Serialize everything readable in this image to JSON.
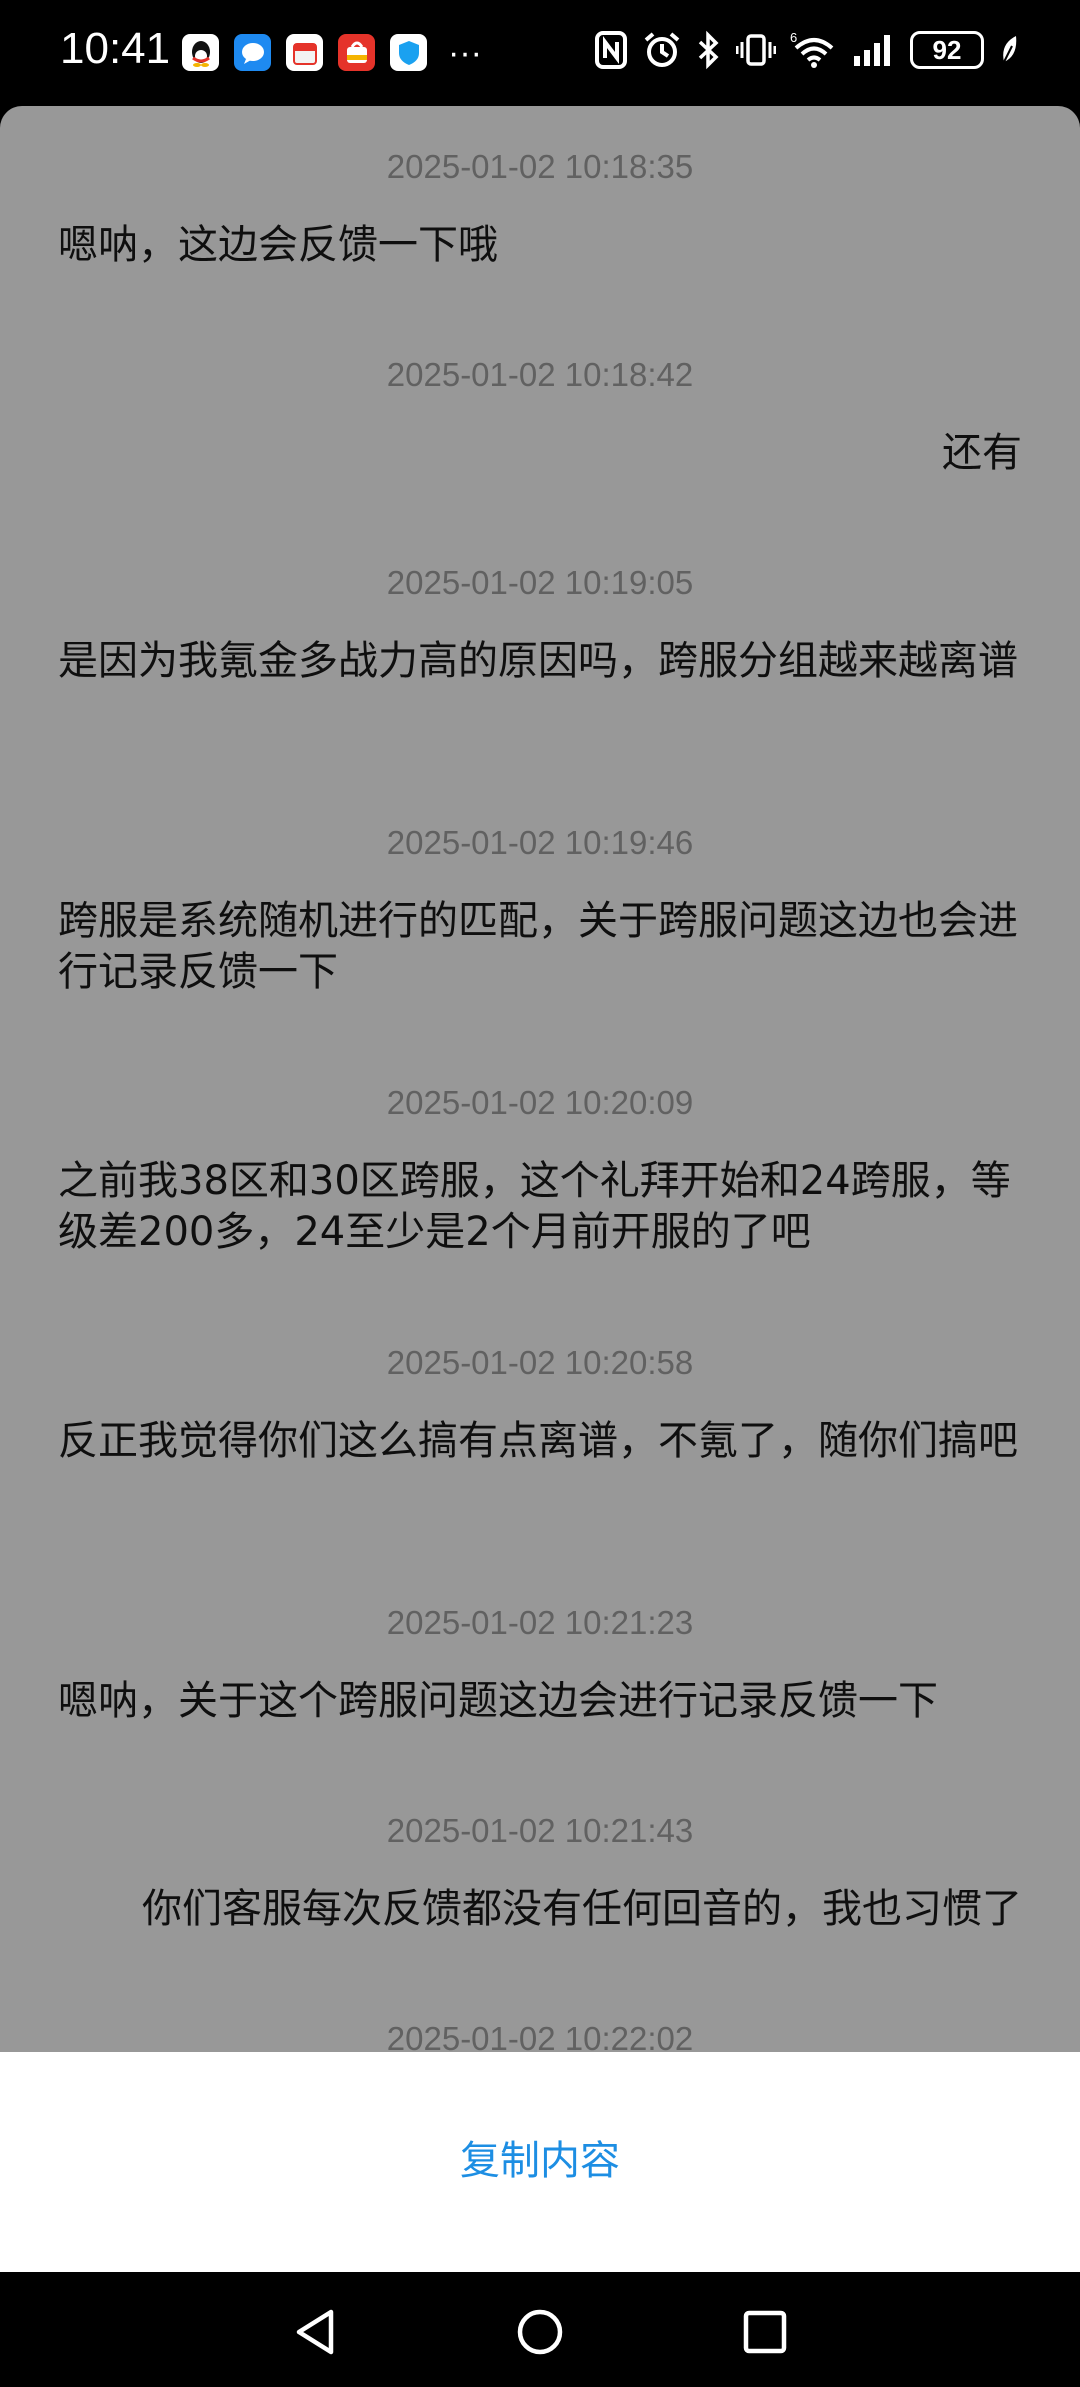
{
  "status_bar": {
    "time": "10:41",
    "battery_level": "92",
    "notification_icons": [
      {
        "name": "qq-icon",
        "color": "#ffffff"
      },
      {
        "name": "message-icon",
        "color": "#1e8af1"
      },
      {
        "name": "calendar-icon",
        "color": "#ffffff"
      },
      {
        "name": "shopping-icon",
        "color": "#e5332a"
      },
      {
        "name": "shield-icon",
        "color": "#1aa1f0"
      }
    ],
    "more_indicator": "···"
  },
  "messages": [
    {
      "time": "2025-01-02 10:18:35",
      "text": "嗯呐，这边会反馈一下哦",
      "align": "left"
    },
    {
      "time": "2025-01-02 10:18:42",
      "text": "还有",
      "align": "right"
    },
    {
      "time": "2025-01-02 10:19:05",
      "text": "是因为我氪金多战力高的原因吗，跨服分组越来越离谱",
      "align": "left"
    },
    {
      "time": "2025-01-02 10:19:46",
      "text": "跨服是系统随机进行的匹配，关于跨服问题这边也会进行记录反馈一下",
      "align": "left"
    },
    {
      "time": "2025-01-02 10:20:09",
      "text": "之前我38区和30区跨服，这个礼拜开始和24跨服，等级差200多，24至少是2个月前开服的了吧",
      "align": "left"
    },
    {
      "time": "2025-01-02 10:20:58",
      "text": "反正我觉得你们这么搞有点离谱，不氪了，随你们搞吧",
      "align": "left"
    },
    {
      "time": "2025-01-02 10:21:23",
      "text": "嗯呐，关于这个跨服问题这边会进行记录反馈一下",
      "align": "left"
    },
    {
      "time": "2025-01-02 10:21:43",
      "text": "你们客服每次反馈都没有任何回音的，我也习惯了",
      "align": "right"
    },
    {
      "time": "2025-01-02 10:22:02",
      "text": "",
      "align": "left"
    }
  ],
  "sheet": {
    "copy_label": "复制内容"
  },
  "colors": {
    "overlay": "#989898",
    "accent": "#1d8ee3",
    "timestamp": "#616161"
  }
}
